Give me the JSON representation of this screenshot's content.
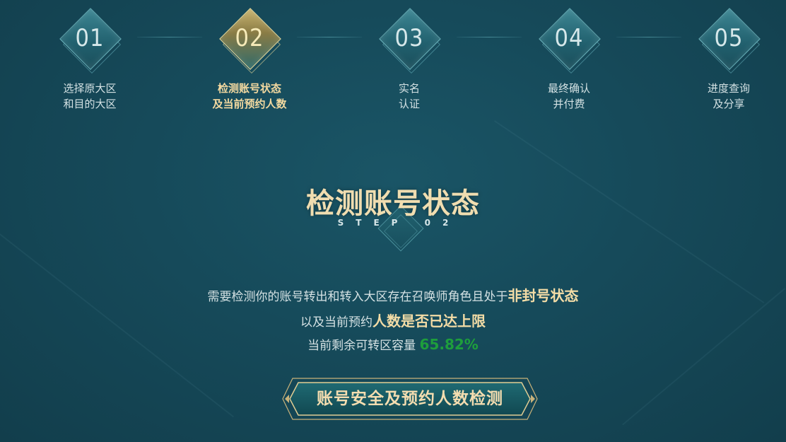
{
  "steps": [
    {
      "num": "01",
      "line1": "选择原大区",
      "line2": "和目的大区",
      "active": false
    },
    {
      "num": "02",
      "line1": "检测账号状态",
      "line2": "及当前预约人数",
      "active": true
    },
    {
      "num": "03",
      "line1": "实名",
      "line2": "认证",
      "active": false
    },
    {
      "num": "04",
      "line1": "最终确认",
      "line2": "并付费",
      "active": false
    },
    {
      "num": "05",
      "line1": "进度查询",
      "line2": "及分享",
      "active": false
    }
  ],
  "section": {
    "title": "检测账号状态",
    "subtitle": "STEP 02"
  },
  "description": {
    "line1_prefix": "需要检测你的账号转出和转入大区存在召唤师角色且处于",
    "line1_highlight": "非封号状态",
    "line2_prefix": "以及当前预约",
    "line2_highlight": "人数是否已达上限",
    "line3_prefix": "当前剩余可转区容量",
    "capacity_percent": "65.82%"
  },
  "button": {
    "label": "账号安全及预约人数检测"
  },
  "colors": {
    "accent_gold": "#f3dca6",
    "capacity_green": "#1e9e3c",
    "background": "#164a5a"
  }
}
